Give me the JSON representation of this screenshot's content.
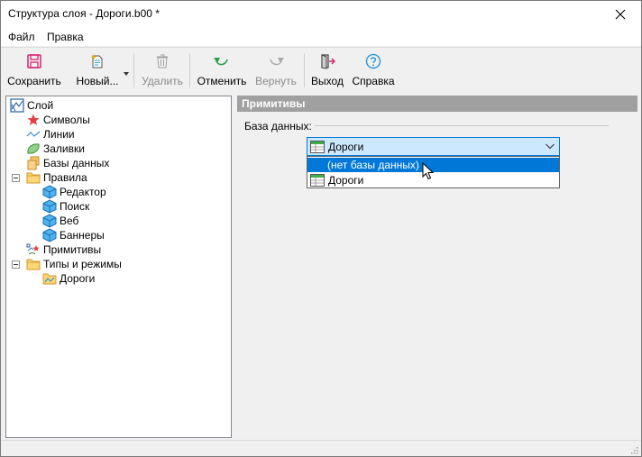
{
  "window": {
    "title": "Структура слоя - Дороги.b00 *"
  },
  "menu": [
    {
      "label": "Файл"
    },
    {
      "label": "Правка"
    }
  ],
  "toolbar": {
    "save": "Сохранить",
    "new": "Новый...",
    "delete": "Удалить",
    "undo": "Отменить",
    "redo": "Вернуть",
    "exit": "Выход",
    "help": "Справка"
  },
  "tree": {
    "root": "Слой",
    "symbols": "Символы",
    "lines": "Линии",
    "fills": "Заливки",
    "databases": "Базы данных",
    "rules": "Правила",
    "editor": "Редактор",
    "search": "Поиск",
    "web": "Веб",
    "banners": "Баннеры",
    "primitives": "Примитивы",
    "types_modes": "Типы и режимы",
    "roads": "Дороги"
  },
  "panel": {
    "header": "Примитивы",
    "database_label": "База данных:",
    "selected_value": "Дороги",
    "options": [
      "(нет базы данных)",
      "Дороги"
    ]
  },
  "colors": {
    "accent": "#0078d7",
    "combo_bg": "#cce8ff",
    "panel_header": "#a0a0a0"
  }
}
